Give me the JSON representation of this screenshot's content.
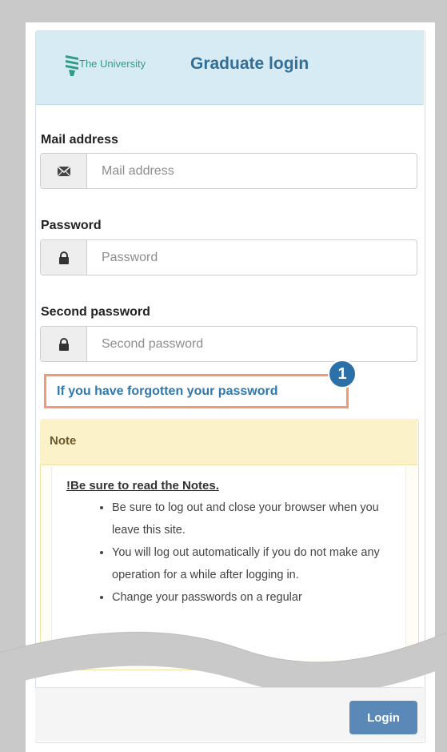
{
  "header": {
    "brand": "The University",
    "title": "Graduate login",
    "logo_color": "#2f9c86",
    "title_color": "#316f99"
  },
  "fields": [
    {
      "label": "Mail address",
      "placeholder": "Mail address",
      "icon": "envelope-icon"
    },
    {
      "label": "Password",
      "placeholder": "Password",
      "icon": "lock-icon"
    },
    {
      "label": "Second password",
      "placeholder": "Second password",
      "icon": "lock-icon"
    }
  ],
  "forgot_link": "If you have forgotten your password",
  "callout_badge": "1",
  "note": {
    "title": "Note",
    "heading": "!Be sure to read the Notes.",
    "items": [
      "Be sure to log out and close your browser when you leave this site.",
      "You will log out automatically if you do not make any operation for a while after logging in.",
      "Change your passwords on a regular"
    ]
  },
  "footer": {
    "login_label": "Login",
    "login_color": "#5a89b8"
  }
}
